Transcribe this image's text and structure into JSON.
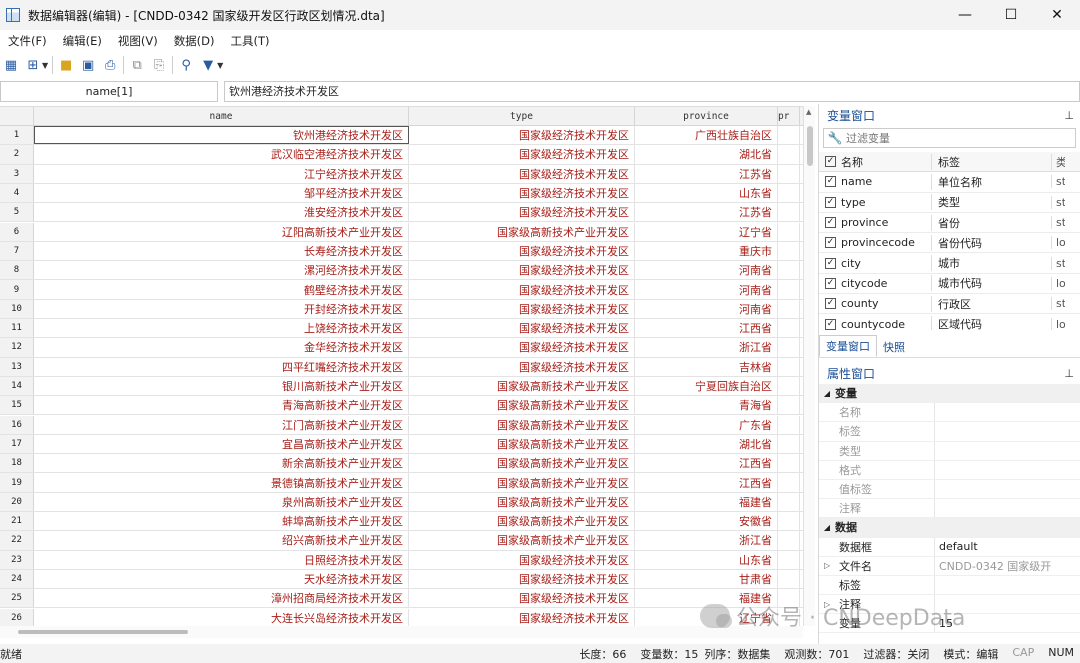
{
  "window": {
    "title": "数据编辑器(编辑) - [CNDD-0342 国家级开发区行政区划情况.dta]",
    "minimize": "—",
    "maximize": "☐",
    "close": "✕"
  },
  "menu": [
    "文件(F)",
    "编辑(E)",
    "视图(V)",
    "数据(D)",
    "工具(T)"
  ],
  "editbar": {
    "cell_name": "name[1]",
    "cell_value": "钦州港经济技术开发区"
  },
  "grid": {
    "columns": [
      "name",
      "type",
      "province",
      "pr"
    ],
    "rows": [
      [
        "1",
        "钦州港经济技术开发区",
        "国家级经济技术开发区",
        "广西壮族自治区"
      ],
      [
        "2",
        "武汉临空港经济技术开发区",
        "国家级经济技术开发区",
        "湖北省"
      ],
      [
        "3",
        "江宁经济技术开发区",
        "国家级经济技术开发区",
        "江苏省"
      ],
      [
        "4",
        "邹平经济技术开发区",
        "国家级经济技术开发区",
        "山东省"
      ],
      [
        "5",
        "淮安经济技术开发区",
        "国家级经济技术开发区",
        "江苏省"
      ],
      [
        "6",
        "辽阳高新技术产业开发区",
        "国家级高新技术产业开发区",
        "辽宁省"
      ],
      [
        "7",
        "长寿经济技术开发区",
        "国家级经济技术开发区",
        "重庆市"
      ],
      [
        "8",
        "漯河经济技术开发区",
        "国家级经济技术开发区",
        "河南省"
      ],
      [
        "9",
        "鹤壁经济技术开发区",
        "国家级经济技术开发区",
        "河南省"
      ],
      [
        "10",
        "开封经济技术开发区",
        "国家级经济技术开发区",
        "河南省"
      ],
      [
        "11",
        "上饶经济技术开发区",
        "国家级经济技术开发区",
        "江西省"
      ],
      [
        "12",
        "金华经济技术开发区",
        "国家级经济技术开发区",
        "浙江省"
      ],
      [
        "13",
        "四平红嘴经济技术开发区",
        "国家级经济技术开发区",
        "吉林省"
      ],
      [
        "14",
        "银川高新技术产业开发区",
        "国家级高新技术产业开发区",
        "宁夏回族自治区"
      ],
      [
        "15",
        "青海高新技术产业开发区",
        "国家级高新技术产业开发区",
        "青海省"
      ],
      [
        "16",
        "江门高新技术产业开发区",
        "国家级高新技术产业开发区",
        "广东省"
      ],
      [
        "17",
        "宜昌高新技术产业开发区",
        "国家级高新技术产业开发区",
        "湖北省"
      ],
      [
        "18",
        "新余高新技术产业开发区",
        "国家级高新技术产业开发区",
        "江西省"
      ],
      [
        "19",
        "景德镇高新技术产业开发区",
        "国家级高新技术产业开发区",
        "江西省"
      ],
      [
        "20",
        "泉州高新技术产业开发区",
        "国家级高新技术产业开发区",
        "福建省"
      ],
      [
        "21",
        "蚌埠高新技术产业开发区",
        "国家级高新技术产业开发区",
        "安徽省"
      ],
      [
        "22",
        "绍兴高新技术产业开发区",
        "国家级高新技术产业开发区",
        "浙江省"
      ],
      [
        "23",
        "日照经济技术开发区",
        "国家级经济技术开发区",
        "山东省"
      ],
      [
        "24",
        "天水经济技术开发区",
        "国家级经济技术开发区",
        "甘肃省"
      ],
      [
        "25",
        "漳州招商局经济技术开发区",
        "国家级经济技术开发区",
        "福建省"
      ],
      [
        "26",
        "大连长兴岛经济技术开发区",
        "国家级经济技术开发区",
        "辽宁省"
      ]
    ]
  },
  "variables_window": {
    "title": "变量窗口",
    "filter_placeholder": "过滤变量",
    "headers": [
      "名称",
      "标签",
      "类"
    ],
    "vars": [
      [
        "name",
        "单位名称",
        "st"
      ],
      [
        "type",
        "类型",
        "st"
      ],
      [
        "province",
        "省份",
        "st"
      ],
      [
        "provincecode",
        "省份代码",
        "lo"
      ],
      [
        "city",
        "城市",
        "st"
      ],
      [
        "citycode",
        "城市代码",
        "lo"
      ],
      [
        "county",
        "行政区",
        "st"
      ],
      [
        "countycode",
        "区域代码",
        "lo"
      ]
    ],
    "tabs": [
      "变量窗口",
      "快照"
    ]
  },
  "properties_window": {
    "title": "属性窗口",
    "var_section": "变量",
    "var_fields": [
      "名称",
      "标签",
      "类型",
      "格式",
      "值标签",
      "注释"
    ],
    "data_section": "数据",
    "data_fields": [
      [
        "数据框",
        "default"
      ],
      [
        "文件名",
        "CNDD-0342 国家级开"
      ],
      [
        "标签",
        ""
      ],
      [
        "注释",
        ""
      ],
      [
        "变量",
        "15"
      ]
    ]
  },
  "status": {
    "ready": "就绪",
    "length": "长度：66",
    "vars": "变量数：15",
    "order": "列序：数据集",
    "obs": "观测数：701",
    "filter": "过滤器：关闭",
    "mode": "模式：编辑",
    "cap": "CAP",
    "num": "NUM"
  },
  "watermark": "公众号 · CNDeepData"
}
